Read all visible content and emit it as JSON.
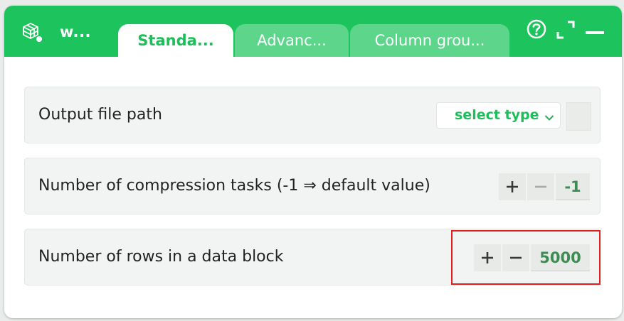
{
  "header": {
    "title": "w...",
    "tabs": [
      {
        "label": "Standa...",
        "active": true
      },
      {
        "label": "Advanc...",
        "active": false
      },
      {
        "label": "Column grou...",
        "active": false
      }
    ],
    "icons": [
      "node-cube-icon",
      "help-icon",
      "expand-icon",
      "minimize-icon"
    ],
    "accent_color": "#1dc35c"
  },
  "settings": {
    "output_path": {
      "label": "Output file path",
      "select_label": "select type"
    },
    "compression_tasks": {
      "label": "Number of compression tasks (-1 ⇒ default value)",
      "value": "-1"
    },
    "rows_per_block": {
      "label": "Number of rows in a data block",
      "value": "5000"
    }
  }
}
